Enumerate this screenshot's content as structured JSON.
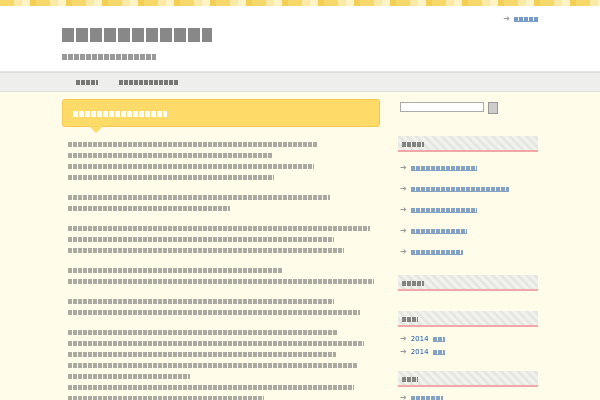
{
  "header": {
    "site_title": "",
    "site_description": "",
    "top_link": ""
  },
  "nav": {
    "items": [
      {
        "label": ""
      },
      {
        "label": ""
      }
    ]
  },
  "post": {
    "title": "",
    "paragraphs": [
      [
        "",
        "",
        "",
        ""
      ],
      [
        "",
        ""
      ],
      [
        "",
        "",
        ""
      ],
      [
        "",
        ""
      ],
      [
        "",
        ""
      ],
      [
        "",
        "",
        "",
        "",
        "",
        ""
      ]
    ]
  },
  "sidebar": {
    "search_placeholder": "",
    "search_button": "",
    "recent_posts_title": "",
    "recent_posts": [
      "",
      "",
      "",
      "",
      ""
    ],
    "comments_title": "",
    "archives_title": "",
    "archives": [
      "2014",
      "2014"
    ],
    "categories_title": "",
    "categories": [
      ""
    ]
  },
  "colors": {
    "accent": "#fedb69",
    "link": "#1e5aa8",
    "background": "#fffcea"
  }
}
